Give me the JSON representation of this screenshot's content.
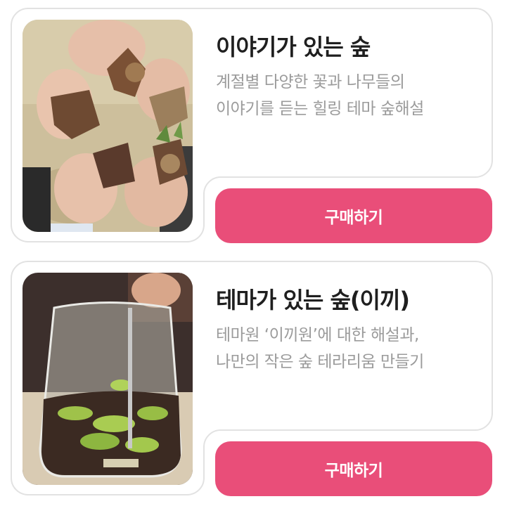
{
  "products": [
    {
      "title": "이야기가 있는 숲",
      "desc_line1": "계절별 다양한 꽃과 나무들의",
      "desc_line2": "이야기를 듣는 힐링 테마 숲해설",
      "buy_label": "구매하기"
    },
    {
      "title": "테마가 있는 숲(이끼)",
      "desc_line1": "테마원 ‘이끼원’에 대한 해설과,",
      "desc_line2": "나만의 작은 숲 테라리움 만들기",
      "buy_label": "구매하기"
    }
  ],
  "colors": {
    "accent": "#e94e79",
    "title": "#1f1f1f",
    "desc": "#9b9b9b",
    "border": "#e2e2e2"
  }
}
